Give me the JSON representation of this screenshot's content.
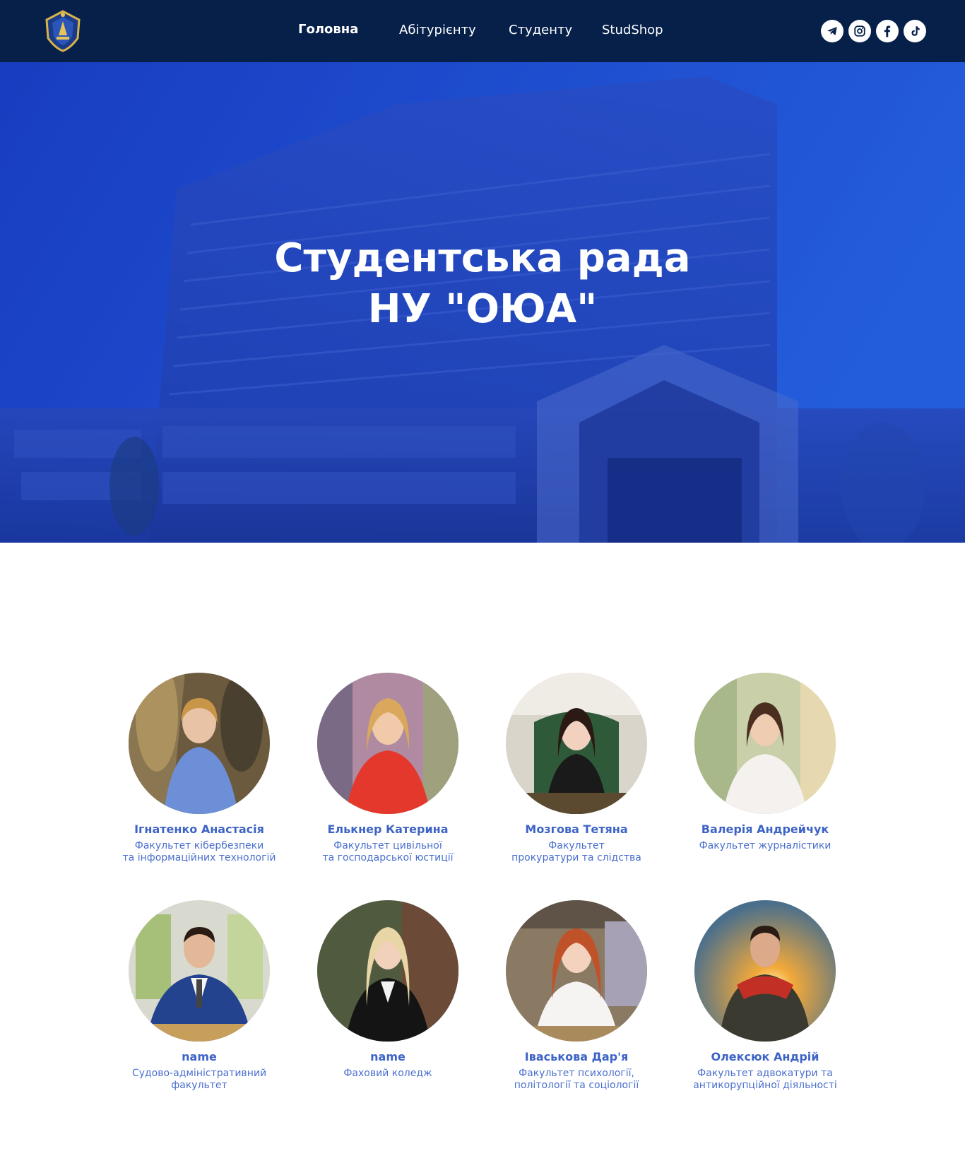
{
  "header": {
    "nav": [
      {
        "label": "Головна",
        "active": true
      },
      {
        "label": "Абітурієнту",
        "active": false
      },
      {
        "label": "Студенту",
        "active": false
      },
      {
        "label": "StudShop",
        "active": false
      }
    ],
    "social": [
      "telegram-icon",
      "instagram-icon",
      "facebook-icon",
      "tiktok-icon"
    ]
  },
  "hero": {
    "title_line1": "Студентська рада",
    "title_line2": "НУ \"ОЮА\""
  },
  "members": [
    {
      "name": "Ігнатенко Анастасія",
      "faculty": "Факультет кібербезпеки\nта інформаційних технологій"
    },
    {
      "name": "Елькнер Катерина",
      "faculty": "Факультет цивільної\nта господарської юстиції"
    },
    {
      "name": "Мозгова Тетяна",
      "faculty": "Факультет\nпрокуратури та слідства"
    },
    {
      "name": "Валерія Андрейчук",
      "faculty": "Факультет журналістики"
    },
    {
      "name": "name",
      "faculty": "Судово-адміністративний\nфакультет"
    },
    {
      "name": "name",
      "faculty": "Фаховий коледж"
    },
    {
      "name": "Іваськова Дар'я",
      "faculty": "Факультет психології,\nполітології та соціології"
    },
    {
      "name": "Олексюк Андрій",
      "faculty": "Факультет адвокатури та\nантикорупційної діяльності"
    }
  ],
  "colors": {
    "header_bg": "#062049",
    "hero_blue": "#1d3fb8",
    "accent": "#3d63c6"
  }
}
